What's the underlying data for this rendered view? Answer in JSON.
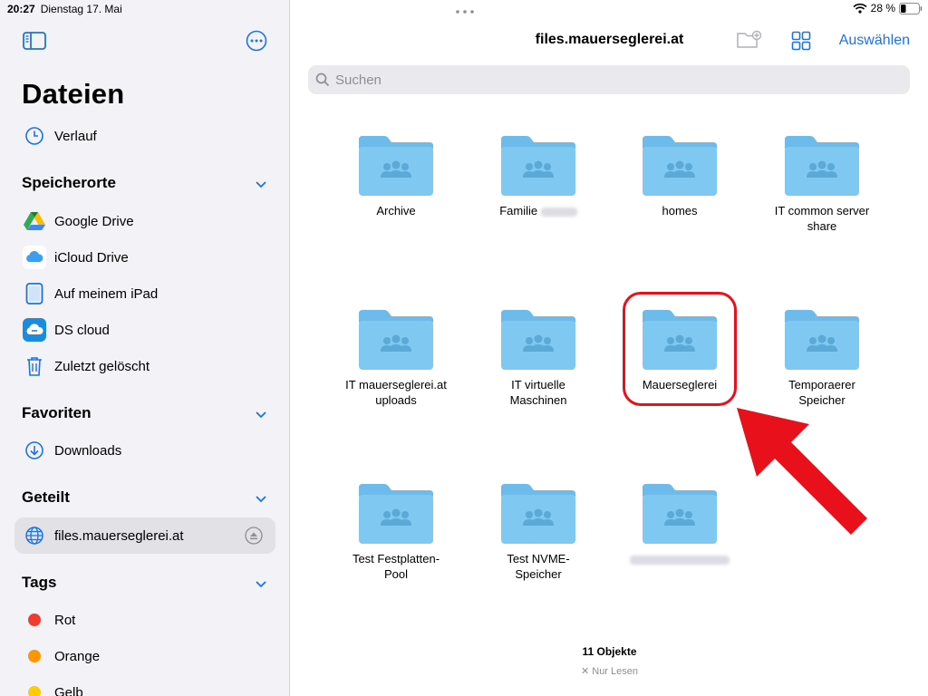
{
  "status": {
    "time": "20:27",
    "date": "Dienstag 17. Mai",
    "battery": "28 %"
  },
  "sidebar": {
    "title": "Dateien",
    "recent": "Verlauf",
    "sections": {
      "locations": "Speicherorte",
      "favorites": "Favoriten",
      "shared": "Geteilt",
      "tags": "Tags"
    },
    "locations": [
      {
        "label": "Google Drive",
        "icon": "google-drive-icon"
      },
      {
        "label": "iCloud Drive",
        "icon": "icloud-icon"
      },
      {
        "label": "Auf meinem iPad",
        "icon": "ipad-icon"
      },
      {
        "label": "DS cloud",
        "icon": "ds-cloud-icon"
      },
      {
        "label": "Zuletzt gelöscht",
        "icon": "trash-icon"
      }
    ],
    "favorites": [
      {
        "label": "Downloads",
        "icon": "download-icon"
      }
    ],
    "shared": [
      {
        "label": "files.mauerseglerei.at",
        "icon": "globe-icon"
      }
    ],
    "tags": [
      {
        "label": "Rot",
        "color": "#f23b2f"
      },
      {
        "label": "Orange",
        "color": "#ff9500"
      },
      {
        "label": "Gelb",
        "color": "#ffcc00"
      }
    ]
  },
  "main": {
    "title": "files.mauerseglerei.at",
    "select_label": "Auswählen",
    "search_placeholder": "Suchen",
    "folders": [
      {
        "line1": "Archive",
        "line2": ""
      },
      {
        "line1": "Familie",
        "line2": ""
      },
      {
        "line1": "homes",
        "line2": ""
      },
      {
        "line1": "IT common server",
        "line2": "share"
      },
      {
        "line1": "IT mauerseglerei.at",
        "line2": "uploads"
      },
      {
        "line1": "IT virtuelle",
        "line2": "Maschinen"
      },
      {
        "line1": "Mauerseglerei",
        "line2": ""
      },
      {
        "line1": "Temporaerer",
        "line2": "Speicher"
      },
      {
        "line1": "Test Festplatten-",
        "line2": "Pool"
      },
      {
        "line1": "Test NVME-",
        "line2": "Speicher"
      },
      {
        "line1": "",
        "line2": ""
      }
    ],
    "count": "11 Objekte",
    "readonly": "Nur Lesen"
  },
  "colors": {
    "accent": "#1a73e8",
    "folder": "#7ec8f2",
    "folder_tab": "#6cbbea",
    "folder_glyph": "#5aa9d6",
    "highlight": "#e8101a"
  }
}
